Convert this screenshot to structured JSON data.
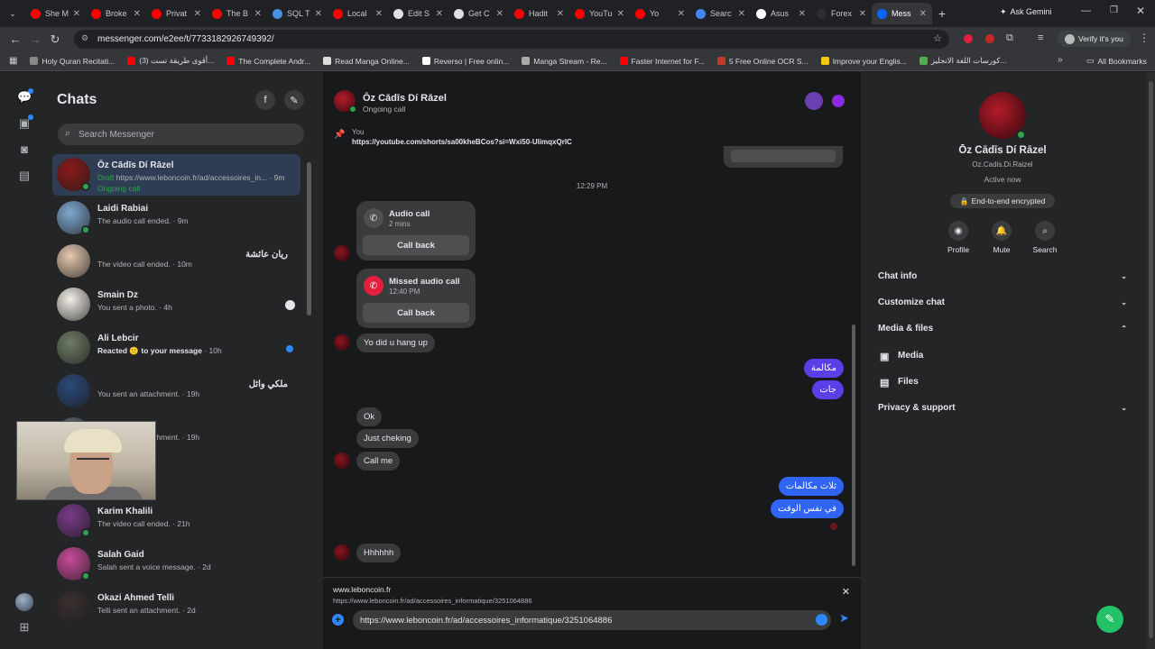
{
  "browser": {
    "tabs": [
      {
        "label": "She M",
        "color": "#ff0000"
      },
      {
        "label": "Broke",
        "color": "#ff0000"
      },
      {
        "label": "Privat",
        "color": "#ff0000"
      },
      {
        "label": "The B",
        "color": "#ff0000"
      },
      {
        "label": "SQL T",
        "color": "#4a90e2"
      },
      {
        "label": "Local",
        "color": "#ff0000"
      },
      {
        "label": "Edit S",
        "color": "#e0e0e0"
      },
      {
        "label": "Get C",
        "color": "#e0e0e0"
      },
      {
        "label": "Hadit",
        "color": "#ff0000"
      },
      {
        "label": "YouTu",
        "color": "#ff0000"
      },
      {
        "label": "Yo",
        "color": "#ff0000"
      },
      {
        "label": "Searc",
        "color": "#4285f4"
      },
      {
        "label": "Asus",
        "color": "#ffffff"
      },
      {
        "label": "Forex",
        "color": "#2f2f2f"
      },
      {
        "label": "Mess",
        "color": "#0866ff",
        "active": true
      }
    ],
    "ask_gemini": "Ask Gemini",
    "url": "messenger.com/e2ee/t/7733182926749392/",
    "verify": "Verify it's you",
    "bookmarks": [
      {
        "label": "Holy Quran Recitati...",
        "color": "#888888"
      },
      {
        "label": "(3) أقوى طريقة تست...",
        "color": "#ff0000"
      },
      {
        "label": "The Complete Andr...",
        "color": "#ff0000"
      },
      {
        "label": "Read Manga Online...",
        "color": "#dddddd"
      },
      {
        "label": "Reverso | Free onlin...",
        "color": "#ffffff"
      },
      {
        "label": "Manga Stream - Re...",
        "color": "#aaaaaa"
      },
      {
        "label": "Faster Internet for F...",
        "color": "#ff0000"
      },
      {
        "label": "5 Free Online OCR S...",
        "color": "#c0392b"
      },
      {
        "label": "Improve your Englis...",
        "color": "#f5c518"
      },
      {
        "label": "كورسات اللغة الانجليز...",
        "color": "#4caf50"
      }
    ],
    "all_bookmarks": "All Bookmarks"
  },
  "chats": {
    "title": "Chats",
    "search_placeholder": "Search Messenger",
    "items": [
      {
        "name": "Ōz Cādīs Dí Rāzel",
        "draft": "Draft",
        "preview": " https://www.leboncoin.fr/ad/accessoires_in... · 9m",
        "call": "Ongoing call",
        "avatar": "#8b1a1a",
        "online": true,
        "selected": true
      },
      {
        "name": "Laidi Rabiai",
        "preview": "The audio call ended. · 9m",
        "avatar": "#7fa8d0",
        "online": true
      },
      {
        "name": "ريان عائشة",
        "preview": "The video call ended. · 10m",
        "avatar": "#e6c9b0",
        "rtl": true
      },
      {
        "name": "Smain Dz",
        "preview": "You sent a photo. · 4h",
        "avatar": "#f2efe6",
        "seen": true
      },
      {
        "name": "Ali Lebcir",
        "reacted": "Reacted 🙂 to your message",
        "preview": " · 10h",
        "avatar": "#6d7c65",
        "unread": true
      },
      {
        "name": "ملكي وائل",
        "preview": "You sent an attachment. · 19h",
        "avatar": "#2b4a7a",
        "rtl": true
      },
      {
        "name": "",
        "preview": "You sent an attachment. · 19h",
        "avatar": "#5a6a7a"
      },
      {
        "name": "",
        "preview": "· 20h",
        "avatar": "#6a5a4a"
      },
      {
        "name": "Karim Khalili",
        "preview": "The video call ended. · 21h",
        "avatar": "#7a3a8a",
        "online": true
      },
      {
        "name": "Salah Gaid",
        "preview": "Salah sent a voice message. · 2d",
        "avatar": "#c84b9a",
        "online": true
      },
      {
        "name": "Okazi Ahmed Telli",
        "preview": "Telli sent an attachment. · 2d",
        "avatar": "#3a3030"
      }
    ]
  },
  "conversation": {
    "name": "Ōz Cādīs Dí Rāzel",
    "status": "Ongoing call",
    "pinned_by": "You",
    "pinned_link": "https://youtube.com/shorts/sa00kheBCos?si=Wxi50-UlimqxQrlC",
    "time": "12:29 PM",
    "call1": {
      "title": "Audio call",
      "sub": "2 mins",
      "button": "Call back"
    },
    "call2": {
      "title": "Missed audio call",
      "sub": "12:40 PM",
      "button": "Call back"
    },
    "msg_yo": "Yo did u hang up",
    "out1": "مكالمة",
    "out2": "جات",
    "msg_ok": "Ok",
    "msg_checking": "Just cheking",
    "msg_callme": "Call me",
    "out3": "ثلاث مكالمات",
    "out4": "في نفس الوقت",
    "msg_hh": "Hhhhhh",
    "link_site": "www.leboncoin.fr",
    "link_url": "https://www.leboncoin.fr/ad/accessoires_informatique/3251064886",
    "composer": "https://www.leboncoin.fr/ad/accessoires_informatique/3251064886"
  },
  "info": {
    "name": "Ōz Cādīs Dí Rāzel",
    "username": "Oz.Cadis.Di.Raizel",
    "active": "Active now",
    "e2ee": "End-to-end encrypted",
    "actions": {
      "profile": "Profile",
      "mute": "Mute",
      "search": "Search"
    },
    "chat_info": "Chat info",
    "customize": "Customize chat",
    "media_files": "Media & files",
    "media": "Media",
    "files": "Files",
    "privacy": "Privacy & support"
  }
}
